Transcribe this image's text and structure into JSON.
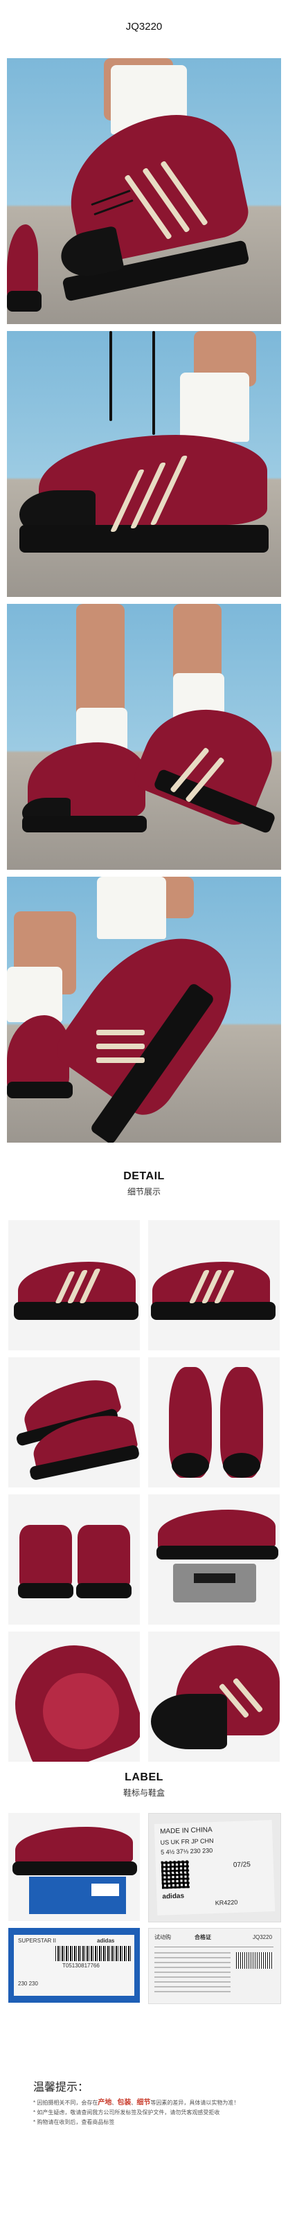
{
  "header": {
    "sku": "JQ3220"
  },
  "detail": {
    "title_en": "DETAIL",
    "title_cn": "细节展示"
  },
  "label": {
    "title_en": "LABEL",
    "title_cn": "鞋标与鞋盒"
  },
  "tongue_label": {
    "made_in": "MADE IN CHINA",
    "size_header": "US UK FR JP CHN",
    "size_values": "5  4½  37⅓  230  230",
    "date": "07/25",
    "brand": "adidas",
    "code": "KR4220"
  },
  "box_label": {
    "product": "SUPERSTAR II",
    "barcode_number": "T05130817766",
    "size_row": "230  230",
    "brand": "adidas"
  },
  "hangtag": {
    "left_title": "试动购",
    "qualified": "合格证",
    "sku": "JQ3220"
  },
  "notice": {
    "title": "温馨提示：",
    "lines": [
      "* 因拍摄相关不同，会存在产地、包装、细节等因素的差异，具体请以实物为准！",
      "* 如产生疑虑，敬请查阅我方公司所发标签及保护文件，请勿凭客观感受拒收",
      "* 购物请在收到后，查看商品标签"
    ],
    "highlights": [
      "产地",
      "包装",
      "细节"
    ]
  },
  "colors": {
    "suede": "#8c1530",
    "sole": "#101010",
    "stripe": "#e8dcc4",
    "sky": "#7db8d9",
    "highlight": "#c83a2a",
    "box_blue": "#1e5fb6"
  }
}
